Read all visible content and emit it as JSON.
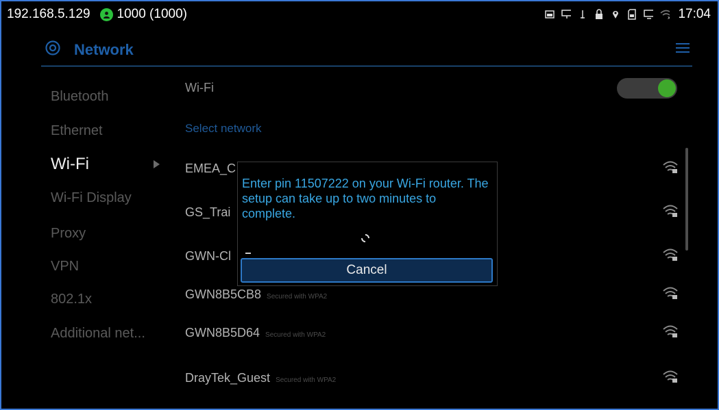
{
  "statusbar": {
    "ip": "192.168.5.129",
    "extension": "1000 (1000)",
    "time": "17:04",
    "icons": [
      "screenshot-icon",
      "network-icon",
      "usb-icon",
      "lock-icon",
      "location-icon",
      "sd-card-icon",
      "display-icon",
      "wifi-off-icon"
    ]
  },
  "app": {
    "title": "Network"
  },
  "nav": {
    "items": [
      {
        "label": "Bluetooth"
      },
      {
        "label": "Ethernet"
      },
      {
        "label": "Wi-Fi"
      },
      {
        "label": "Wi-Fi Display"
      },
      {
        "label": "Proxy"
      },
      {
        "label": "VPN"
      },
      {
        "label": "802.1x"
      },
      {
        "label": "Additional net..."
      }
    ],
    "active_index": 2
  },
  "content": {
    "wifi_label": "Wi-Fi",
    "wifi_enabled": true,
    "select_network": "Select network",
    "networks": [
      {
        "name": "EMEA_C",
        "sub": ""
      },
      {
        "name": "GS_Trai",
        "sub": ""
      },
      {
        "name": "GWN-Cl",
        "sub": ""
      },
      {
        "name": "GWN8B5CB8",
        "sub": "Secured with WPA2"
      },
      {
        "name": "GWN8B5D64",
        "sub": "Secured with WPA2"
      },
      {
        "name": "DrayTek_Guest",
        "sub": "Secured with WPA2"
      }
    ]
  },
  "dialog": {
    "message": "Enter pin 11507222 on your Wi-Fi router. The setup can take up to two minutes to complete.",
    "cancel_label": "Cancel"
  },
  "colors": {
    "accent": "#2d79c7",
    "toggle_on": "#3fa92c",
    "message": "#39a7e3"
  }
}
